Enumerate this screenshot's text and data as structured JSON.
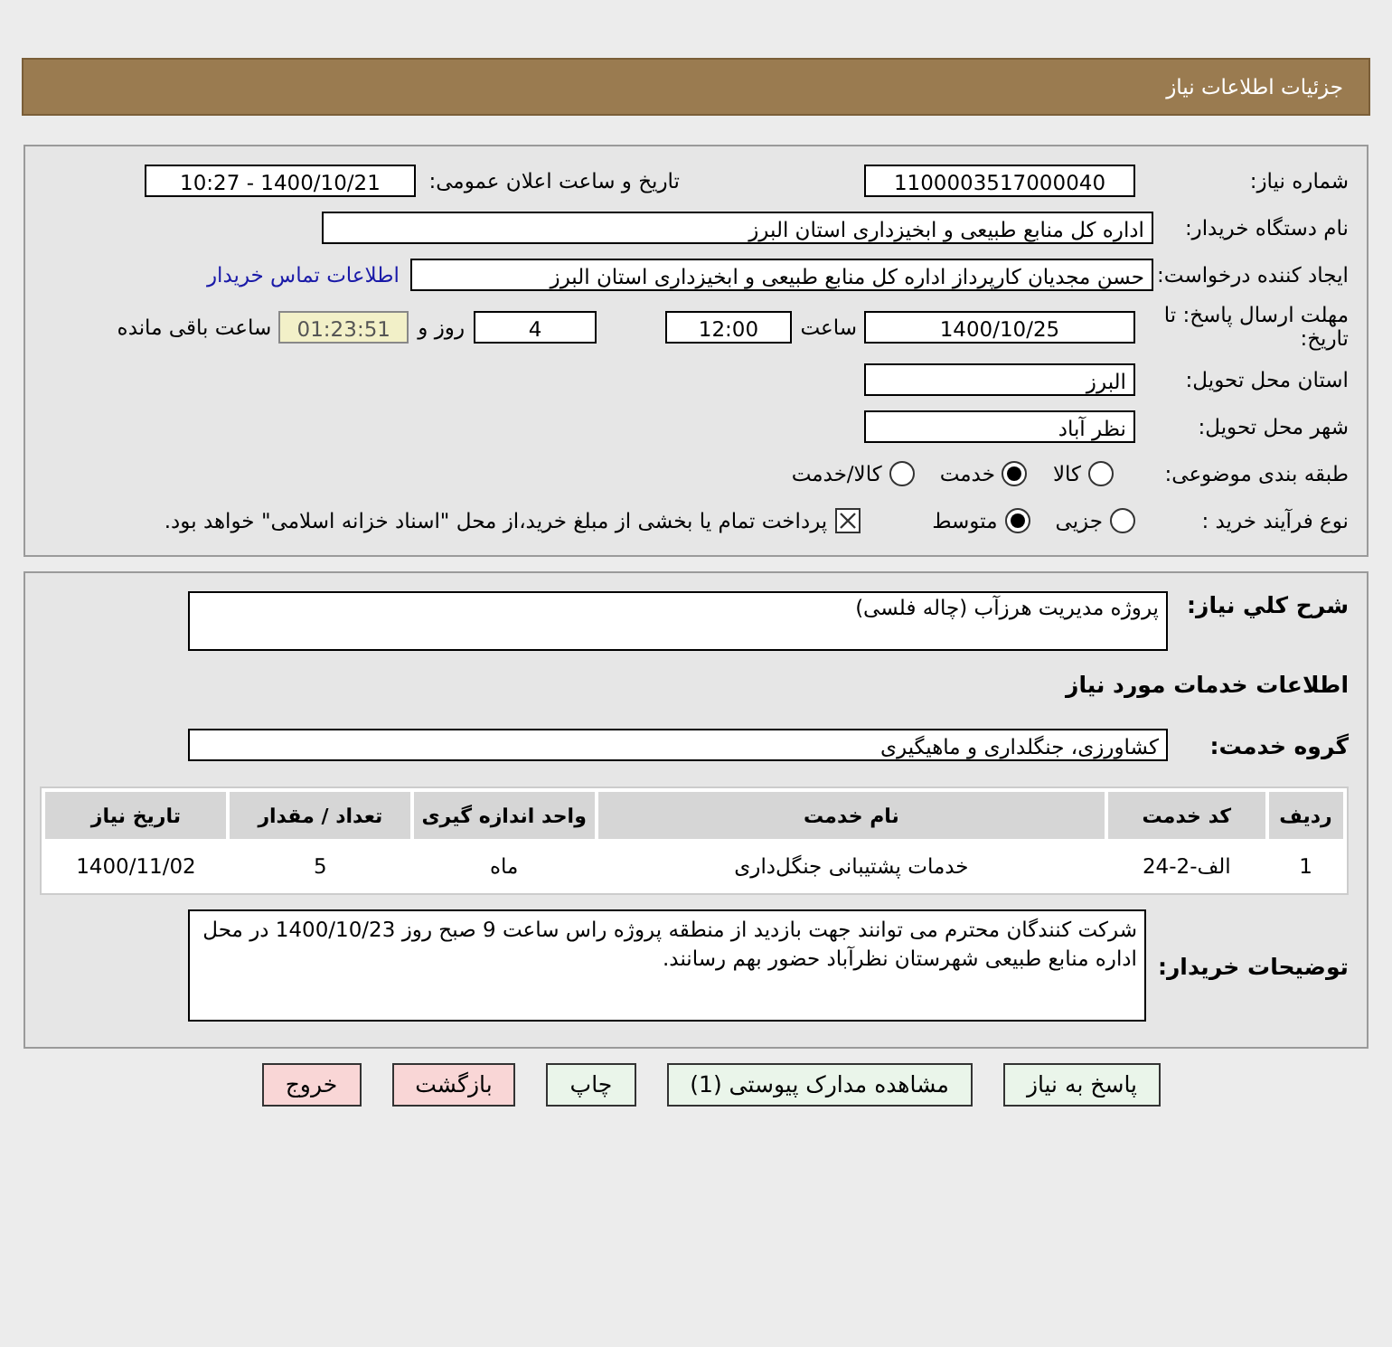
{
  "header": {
    "title": "جزئیات اطلاعات نیاز"
  },
  "details": {
    "need_number": {
      "label": "شماره نیاز:",
      "value": "1100003517000040"
    },
    "announce_datetime": {
      "label": "تاریخ و ساعت اعلان عمومی:",
      "value": "1400/10/21 - 10:27"
    },
    "buyer_org": {
      "label": "نام دستگاه خریدار:",
      "value": "اداره کل منابع طبیعی و ابخیزداری استان البرز"
    },
    "requester": {
      "label": "ایجاد کننده درخواست:",
      "value": "حسن مجدیان کارپرداز اداره کل منابع طبیعی و ابخیزداری استان البرز",
      "link": "اطلاعات تماس خریدار"
    },
    "deadline": {
      "label": "مهلت ارسال پاسخ: تا تاریخ:",
      "date": "1400/10/25",
      "time_label": "ساعت",
      "time": "12:00",
      "days": "4",
      "days_label": "روز و",
      "remaining": "01:23:51",
      "remaining_label": "ساعت باقی مانده"
    },
    "province": {
      "label": "استان محل تحویل:",
      "value": "البرز"
    },
    "city": {
      "label": "شهر محل تحویل:",
      "value": "نظر آباد"
    },
    "category": {
      "label": "طبقه بندی موضوعی:",
      "options": [
        {
          "label": "کالا",
          "selected": false
        },
        {
          "label": "خدمت",
          "selected": true
        },
        {
          "label": "کالا/خدمت",
          "selected": false
        }
      ]
    },
    "process": {
      "label": "نوع فرآیند خرید :",
      "options": [
        {
          "label": "جزیی",
          "selected": false
        },
        {
          "label": "متوسط",
          "selected": true
        }
      ],
      "treasury": {
        "label": "پرداخت تمام یا بخشی از مبلغ خرید،از محل \"اسناد خزانه اسلامی\" خواهد بود.",
        "checked": true
      }
    }
  },
  "needs": {
    "description": {
      "label": "شرح کلي نیاز:",
      "value": "پروژه مدیریت هرزآب (چاله فلسی)"
    },
    "services_heading": "اطلاعات خدمات مورد نیاز",
    "service_group": {
      "label": "گروه خدمت:",
      "value": "کشاورزی، جنگلداری و ماهیگیری"
    },
    "table": {
      "columns": [
        "ردیف",
        "کد خدمت",
        "نام خدمت",
        "واحد اندازه گیری",
        "تعداد / مقدار",
        "تاریخ نیاز"
      ],
      "rows": [
        [
          "1",
          "الف-2-24",
          "خدمات پشتیبانی جنگل‌داری",
          "ماه",
          "5",
          "1400/11/02"
        ]
      ]
    },
    "buyer_notes": {
      "label": "توضیحات خریدار:",
      "value": "شرکت کنندگان محترم می توانند جهت بازدید از منطقه پروژه راس ساعت 9 صبح روز 1400/10/23 در محل اداره منابع طبیعی شهرستان نظرآباد حضور بهم رسانند."
    }
  },
  "buttons": [
    {
      "label": "پاسخ به نیاز",
      "kind": "action"
    },
    {
      "label": "مشاهده مدارک پیوستی (1)",
      "kind": "action"
    },
    {
      "label": "چاپ",
      "kind": "action"
    },
    {
      "label": "بازگشت",
      "kind": "exit"
    },
    {
      "label": "خروج",
      "kind": "exit"
    }
  ]
}
